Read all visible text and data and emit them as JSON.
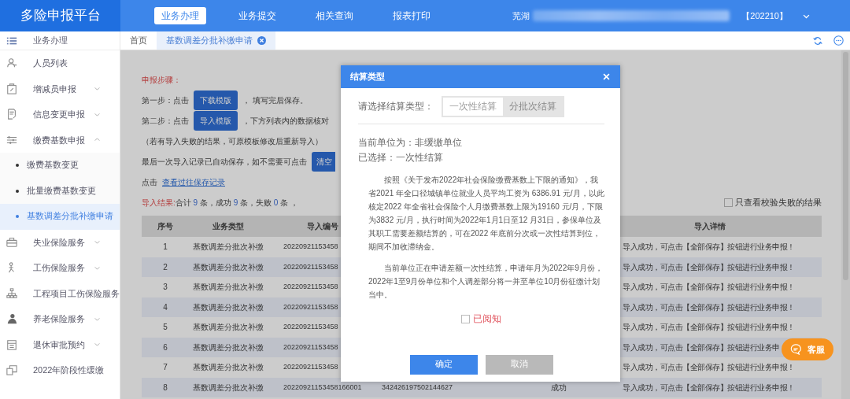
{
  "header": {
    "brand": "多险申报平台",
    "nav": [
      {
        "label": "业务办理",
        "selected": true
      },
      {
        "label": "业务提交",
        "selected": false
      },
      {
        "label": "相关查询",
        "selected": false
      },
      {
        "label": "报表打印",
        "selected": false
      }
    ],
    "user_prefix": "芜湖",
    "period": "【202210】"
  },
  "sidebar": {
    "title": "业务办理",
    "items": [
      {
        "label": "人员列表"
      },
      {
        "label": "增减员申报",
        "expanded": false
      },
      {
        "label": "信息变更申报",
        "expanded": false
      },
      {
        "label": "缴费基数申报",
        "expanded": true,
        "children": [
          {
            "label": "缴费基数变更",
            "selected": false
          },
          {
            "label": "批量缴费基数变更",
            "selected": false
          },
          {
            "label": "基数调差分批补缴申请",
            "selected": true
          }
        ]
      },
      {
        "label": "失业保险服务",
        "expanded": false
      },
      {
        "label": "工伤保险服务",
        "expanded": false
      },
      {
        "label": "工程项目工伤保险服务"
      },
      {
        "label": "养老保险服务",
        "expanded": false
      },
      {
        "label": "退休审批预约",
        "expanded": false
      },
      {
        "label": "2022年阶段性缓缴"
      }
    ]
  },
  "tabs": [
    {
      "label": "首页",
      "selected": false,
      "closable": false
    },
    {
      "label": "基数调差分批补缴申请",
      "selected": true,
      "closable": true
    }
  ],
  "content": {
    "steps_title": "申报步骤：",
    "lines": [
      {
        "kind": "button_line",
        "before": "第一步：点击",
        "button": "下载模版",
        "after": "， 填写完后保存。"
      },
      {
        "kind": "button_line",
        "before": "第二步：点击",
        "button": "导入模版",
        "after": "，下方列表内的数据核对"
      },
      {
        "kind": "text",
        "text": "（若有导入失败的结果，可原模板修改后重新导入）"
      },
      {
        "kind": "button_line",
        "before": "最后一次导入记录已自动保存，如不需要可点击",
        "button": "清空"
      },
      {
        "kind": "link_line",
        "before": "点击",
        "link": "查看过往保存记录"
      }
    ],
    "result": {
      "label": "导入结果:",
      "parts": [
        "合计",
        "9",
        "条，成功",
        "9",
        "条，失败",
        "0",
        "条 ，"
      ]
    },
    "filter": {
      "label": "只查看校验失败的结果",
      "checked": false
    },
    "table": {
      "columns": [
        "序号",
        "业务类型",
        "导入编号",
        "导入详情"
      ],
      "rows": [
        {
          "seq": "1",
          "type": "基数调差分批次补缴",
          "import_no": "20220921153458",
          "detail": "导入成功，可点击【全部保存】按钮进行业务申报！"
        },
        {
          "seq": "2",
          "type": "基数调差分批次补缴",
          "import_no": "20220921153458",
          "detail": "导入成功，可点击【全部保存】按钮进行业务申报！"
        },
        {
          "seq": "3",
          "type": "基数调差分批次补缴",
          "import_no": "20220921153458",
          "detail": "导入成功，可点击【全部保存】按钮进行业务申报！"
        },
        {
          "seq": "4",
          "type": "基数调差分批次补缴",
          "import_no": "20220921153458",
          "detail": "导入成功，可点击【全部保存】按钮进行业务申报！"
        },
        {
          "seq": "5",
          "type": "基数调差分批次补缴",
          "import_no": "20220921153458",
          "detail": "导入成功，可点击【全部保存】按钮进行业务申报！"
        },
        {
          "seq": "6",
          "type": "基数调差分批次补缴",
          "import_no": "20220921153458",
          "detail": "导入成功，可点击【全部保存】按钮进行业务申"
        },
        {
          "seq": "7",
          "type": "基数调差分批次补缴",
          "import_no": "20220921153458",
          "detail": "导入成功，可点击【全部保存】按钮进行业务申报！"
        },
        {
          "seq": "8",
          "type": "基数调差分批次补缴",
          "import_no": "20220921153458166001",
          "column_4": "342426197502144627",
          "column_6": "成功",
          "detail": "导入成功，可点击【全部保存】按钮进行业务申报！"
        }
      ]
    }
  },
  "service_button": "客服",
  "dialog": {
    "title": "结算类型",
    "prompt": "请选择结算类型：",
    "options": [
      {
        "label": "一次性结算",
        "selected": true
      },
      {
        "label": "分批次结算",
        "selected": false
      }
    ],
    "unit_label": "当前单位为：",
    "unit_value": "非缓缴单位",
    "chosen_label": "已选择：",
    "chosen_value": "一次性结算",
    "paragraphs": [
      "按照《关于发布2022年社会保险缴费基数上下限的通知》，我省2021 年全口径城镇单位就业人员平均工资为 6386.91 元/月，以此核定2022 年全省社会保险个人月缴费基数上限为19160 元/月，下限为3832 元/月，执行时间为2022年1月1日至12 月31日，参保单位及其职工需要差额结算的，可在2022 年底前分次或一次性结算到位，期间不加收滞纳金。",
      "当前单位正在申请差额一次性结算，申请年月为2022年9月份，2022年1至9月份单位和个人调差部分将一并至单位10月份征缴计划当中。"
    ],
    "acknowledge": {
      "label": "已阅知",
      "checked": false
    },
    "buttons": [
      {
        "label": "确定",
        "disabled": false
      },
      {
        "label": "取消",
        "disabled": true
      }
    ]
  }
}
